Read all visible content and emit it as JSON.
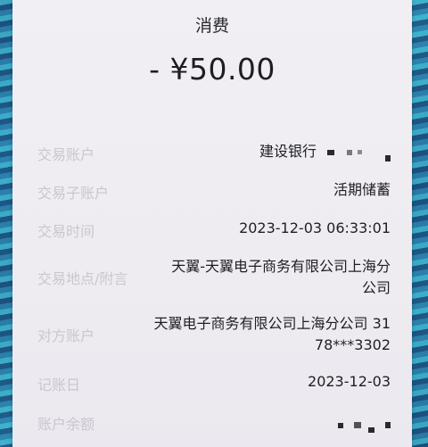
{
  "transaction": {
    "type": "消费",
    "amount": "- ¥50.00"
  },
  "details": [
    {
      "label": "交易账户",
      "value": "建设银行"
    },
    {
      "label": "交易子账户",
      "value": "活期储蓄"
    },
    {
      "label": "交易时间",
      "value": "2023-12-03 06:33:01"
    },
    {
      "label": "交易地点/附言",
      "value_line1": "天翼-天翼电子商务有限公司上海分",
      "value_line2": "公司"
    },
    {
      "label": "对方账户",
      "value_line1": "天翼电子商务有限公司上海分公司 31",
      "value_line2": "78***3302"
    },
    {
      "label": "记账日",
      "value": "2023-12-03"
    },
    {
      "label": "账户余额",
      "value": ""
    }
  ],
  "colors": {
    "label": "#c9c6cf",
    "value": "#1f1f23",
    "background": "#f1eff3"
  }
}
